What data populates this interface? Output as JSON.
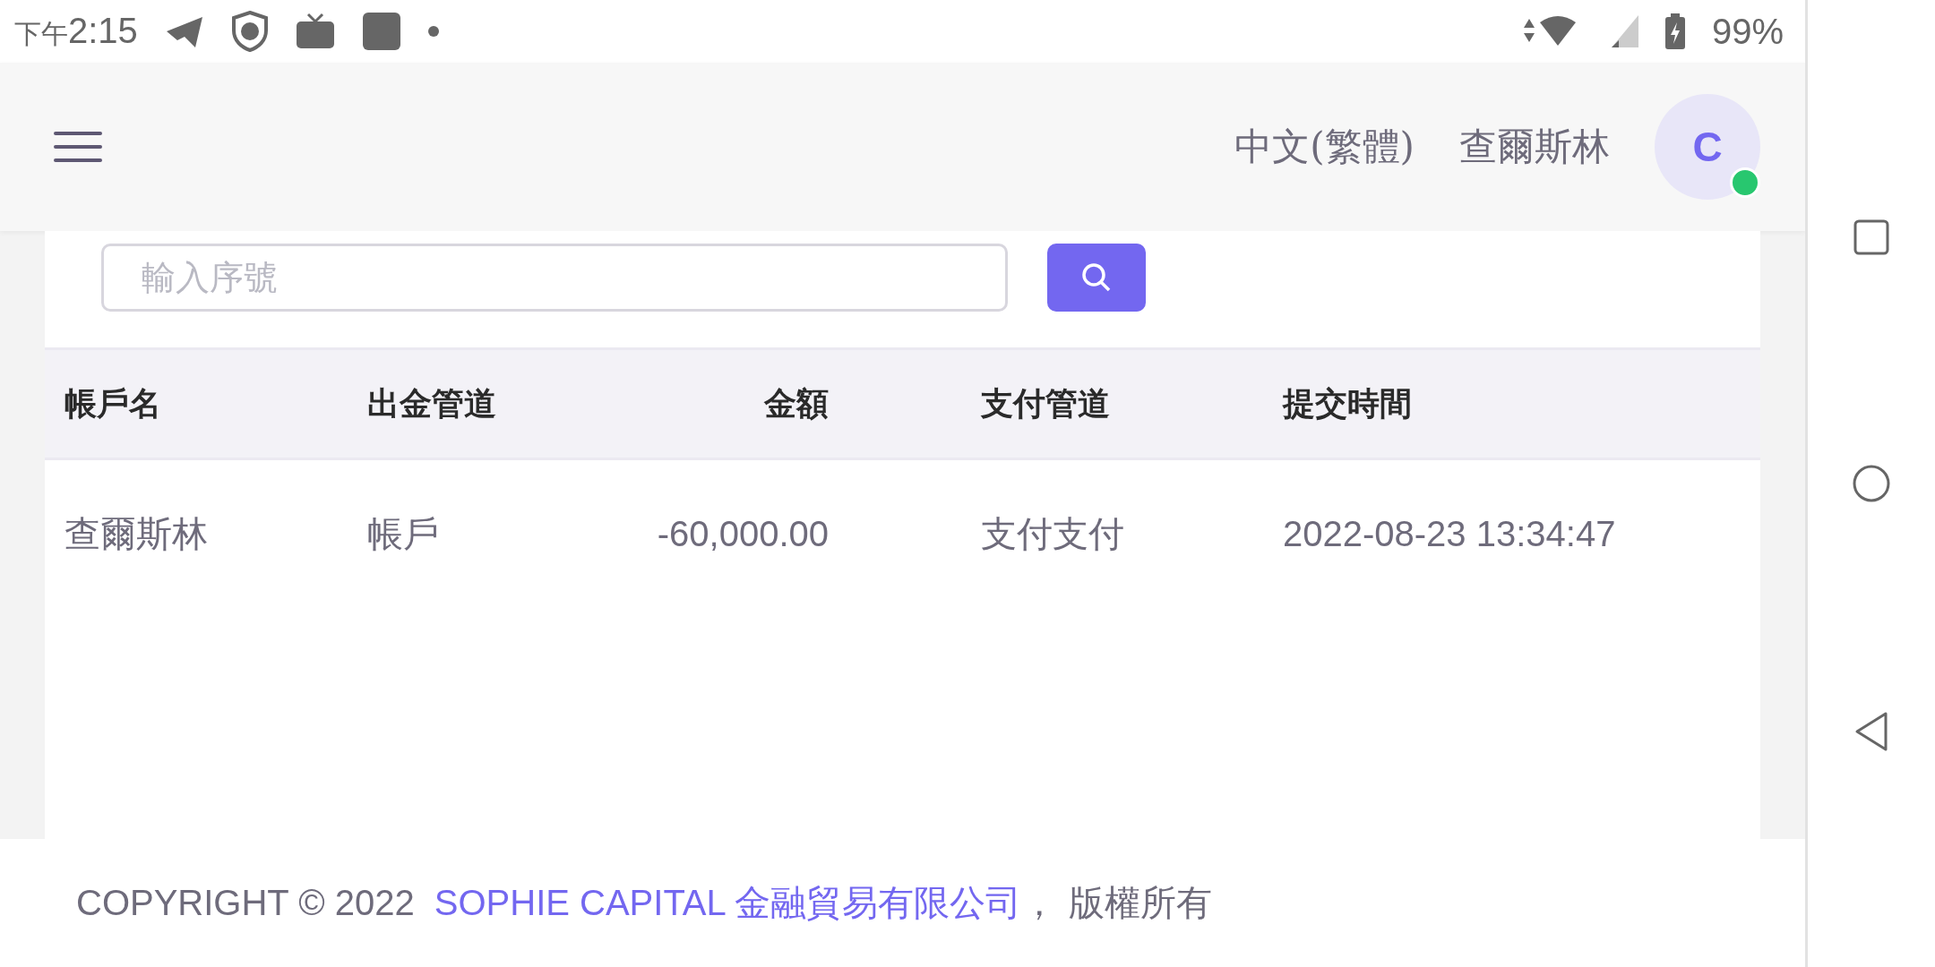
{
  "status_bar": {
    "period": "下午",
    "time": "2:15",
    "battery": "99%"
  },
  "header": {
    "language": "中文(繁體)",
    "username": "查爾斯林",
    "avatar_letter": "C",
    "online": true
  },
  "search": {
    "placeholder": "輸入序號"
  },
  "table": {
    "columns": [
      {
        "label": "帳戶名",
        "numeric": false
      },
      {
        "label": "出金管道",
        "numeric": false
      },
      {
        "label": "金額",
        "numeric": true
      },
      {
        "label": "支付管道",
        "numeric": false
      },
      {
        "label": "提交時間",
        "numeric": false
      }
    ],
    "rows": [
      [
        "查爾斯林",
        "帳戶",
        "-60,000.00",
        "支付支付",
        "2022-08-23 13:34:47"
      ]
    ]
  },
  "footer": {
    "copyright": "COPYRIGHT © 2022",
    "company": "SOPHIE CAPITAL 金融貿易有限公司",
    "suffix": "， 版權所有"
  }
}
